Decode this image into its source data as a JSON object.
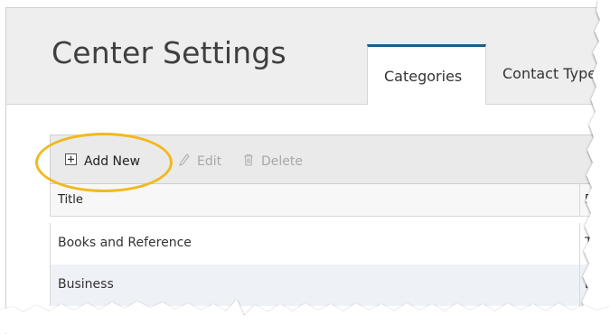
{
  "header": {
    "title": "Center Settings"
  },
  "tabs": [
    {
      "label": "Categories",
      "active": true
    },
    {
      "label": "Contact Type",
      "active": false
    }
  ],
  "toolbar": {
    "add_label": "Add New",
    "edit_label": "Edit",
    "delete_label": "Delete"
  },
  "grid": {
    "columns": [
      "Title",
      "De"
    ],
    "rows": [
      {
        "title": "Books and Reference",
        "desc": "T"
      },
      {
        "title": "Business",
        "desc": "Bu"
      }
    ]
  },
  "icons": [
    "add-icon",
    "pencil-icon",
    "trash-icon"
  ],
  "colors": {
    "tab_accent": "#1a5f85",
    "highlight": "#f2b81e",
    "alt_row": "#eef2f7"
  }
}
